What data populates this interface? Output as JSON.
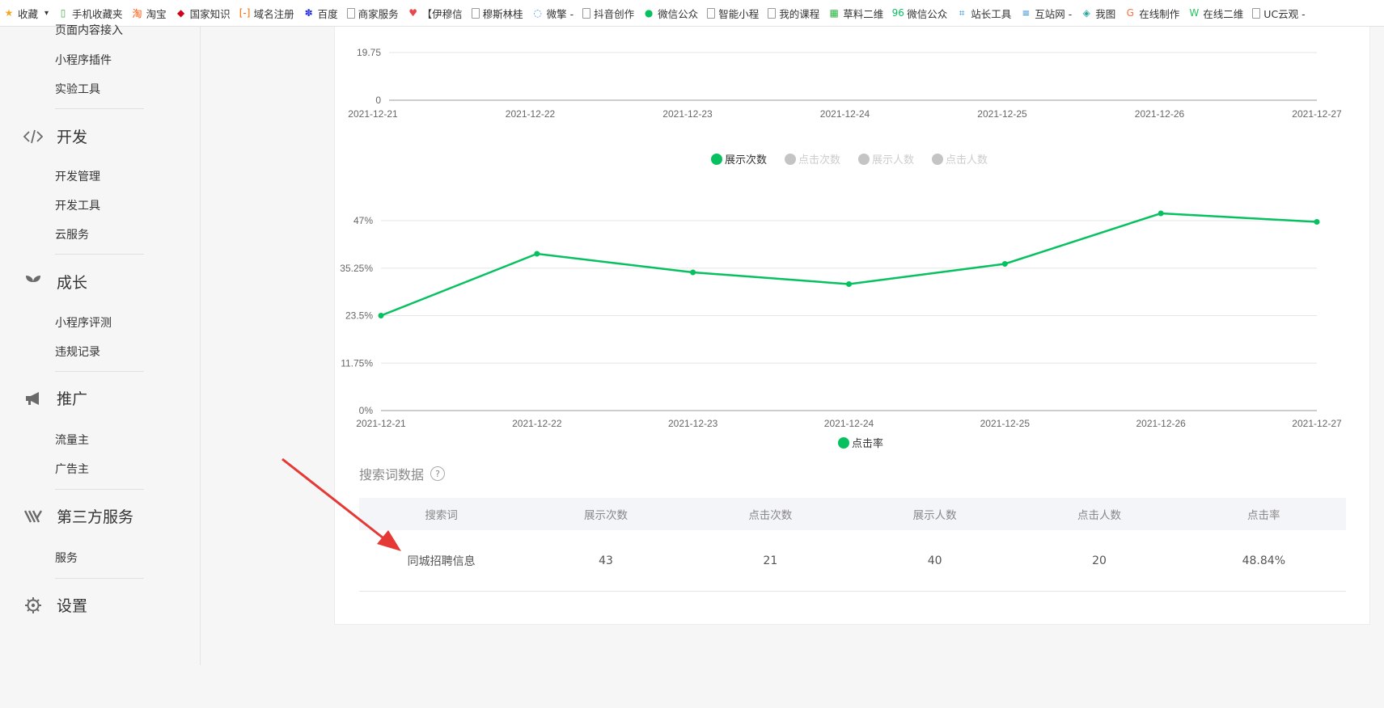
{
  "bookmarks": [
    {
      "label": "收藏",
      "icon": "star-icon",
      "color": "#f5a623"
    },
    {
      "label": "手机收藏夹",
      "icon": "phone-icon",
      "color": "#4caf50"
    },
    {
      "label": "淘宝",
      "icon": "taobao-icon",
      "color": "#ff5000"
    },
    {
      "label": "国家知识",
      "icon": "ipr-icon",
      "color": "#d0021b"
    },
    {
      "label": "域名注册",
      "icon": "domain-icon",
      "color": "#ff6a00"
    },
    {
      "label": "百度",
      "icon": "baidu-icon",
      "color": "#2932e1"
    },
    {
      "label": "商家服务",
      "icon": "file-icon",
      "color": "#999999"
    },
    {
      "label": "【伊穆信",
      "icon": "heart-icon",
      "color": "#e5484d"
    },
    {
      "label": "穆斯林桂",
      "icon": "file-icon",
      "color": "#999999"
    },
    {
      "label": "微擎 -",
      "icon": "weiqing-icon",
      "color": "#3b82f6"
    },
    {
      "label": "抖音创作",
      "icon": "file-icon",
      "color": "#999999"
    },
    {
      "label": "微信公众",
      "icon": "wechat-icon",
      "color": "#07c160"
    },
    {
      "label": "智能小程",
      "icon": "file-icon",
      "color": "#999999"
    },
    {
      "label": "我的课程",
      "icon": "file-icon",
      "color": "#999999"
    },
    {
      "label": "草料二维",
      "icon": "qrcode-icon",
      "color": "#2fb344"
    },
    {
      "label": "微信公众",
      "icon": "ninety-six-icon",
      "color": "#07c160"
    },
    {
      "label": "站长工具",
      "icon": "crop-icon",
      "color": "#1e88e5"
    },
    {
      "label": "互站网 -",
      "icon": "huzhan-icon",
      "color": "#1e88e5"
    },
    {
      "label": "我图",
      "icon": "layers-icon",
      "color": "#26a69a"
    },
    {
      "label": "在线制作",
      "icon": "g-icon",
      "color": "#ff7043"
    },
    {
      "label": "在线二维",
      "icon": "w-icon",
      "color": "#22c55e"
    },
    {
      "label": "UC云观 -",
      "icon": "file-icon",
      "color": "#999999"
    }
  ],
  "sidebar": {
    "top_items": [
      "页面内容接入",
      "小程序插件",
      "实验工具"
    ],
    "sections": [
      {
        "title": "开发",
        "icon": "code-icon",
        "items": [
          "开发管理",
          "开发工具",
          "云服务"
        ]
      },
      {
        "title": "成长",
        "icon": "sprout-icon",
        "items": [
          "小程序评测",
          "违规记录"
        ]
      },
      {
        "title": "推广",
        "icon": "megaphone-icon",
        "items": [
          "流量主",
          "广告主"
        ]
      },
      {
        "title": "第三方服务",
        "icon": "third-party-icon",
        "items": [
          "服务"
        ]
      },
      {
        "title": "设置",
        "icon": "gear-icon",
        "items": []
      }
    ]
  },
  "top_chart": {
    "ytick_top": "19.75",
    "ytick_zero": "0",
    "legend": [
      {
        "label": "展示次数",
        "active": true
      },
      {
        "label": "点击次数",
        "active": false
      },
      {
        "label": "展示人数",
        "active": false
      },
      {
        "label": "点击人数",
        "active": false
      }
    ]
  },
  "chart_data": {
    "type": "line",
    "x": [
      "2021-12-21",
      "2021-12-22",
      "2021-12-23",
      "2021-12-24",
      "2021-12-25",
      "2021-12-26",
      "2021-12-27"
    ],
    "series": [
      {
        "name": "点击率",
        "values": [
          23.5,
          38.8,
          34.2,
          31.3,
          36.3,
          48.8,
          46.7
        ]
      }
    ],
    "yticks": [
      "0%",
      "11.75%",
      "23.5%",
      "35.25%",
      "47%"
    ],
    "ylim": [
      0,
      47
    ],
    "y_unit": "%",
    "grid": true,
    "legend_position": "bottom-center",
    "line_color": "#07c160"
  },
  "search_section": {
    "title": "搜索词数据",
    "help": "?"
  },
  "table": {
    "headers": [
      "搜索词",
      "展示次数",
      "点击次数",
      "展示人数",
      "点击人数",
      "点击率"
    ],
    "rows": [
      [
        "同城招聘信息",
        "43",
        "21",
        "40",
        "20",
        "48.84%"
      ]
    ]
  },
  "colors": {
    "accent": "#07c160",
    "legend_inactive": "#bbbbbb",
    "annotation_arrow": "#e53935"
  }
}
